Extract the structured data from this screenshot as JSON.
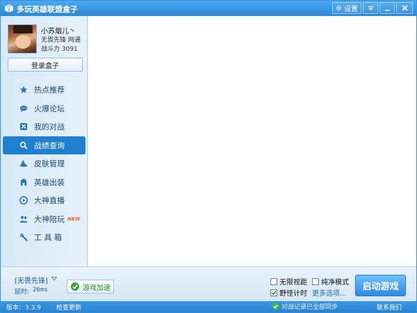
{
  "window": {
    "title": "多玩英雄联盟盒子",
    "settings_label": "设置"
  },
  "user": {
    "name": "小苏烟儿丶",
    "server": "无畏先锋  网通",
    "power": "战斗力  3091"
  },
  "sidebar": {
    "login_label": "登录盒子",
    "items": [
      {
        "label": "热点推荐",
        "icon": "star-icon"
      },
      {
        "label": "火爆论坛",
        "icon": "chat-bubble-icon"
      },
      {
        "label": "我的对战",
        "icon": "battle-icon"
      },
      {
        "label": "战绩查询",
        "icon": "search-icon",
        "active": true
      },
      {
        "label": "皮肤管理",
        "icon": "hat-icon"
      },
      {
        "label": "英雄出装",
        "icon": "armor-icon"
      },
      {
        "label": "大神直播",
        "icon": "play-icon"
      },
      {
        "label": "大神陪玩",
        "icon": "people-icon",
        "badge": "NEW"
      },
      {
        "label": "工 具 箱",
        "icon": "wrench-icon"
      }
    ]
  },
  "bottom": {
    "mode_select": "[无畏先锋]",
    "latency_label": "延时:",
    "latency_value": "26ms",
    "boost_label": "游戏加速",
    "options": {
      "unlimited_view": {
        "label": "无限视距",
        "checked": false
      },
      "pure_mode": {
        "label": "纯净模式",
        "checked": false
      },
      "jungle_timer": {
        "label": "野怪计时",
        "checked": true
      }
    },
    "more_options": "更多选项...",
    "launch_label": "启动游戏"
  },
  "statusbar": {
    "version": "版本：3.3.9",
    "check_update": "检查更新",
    "sync_status": "对战记录已全部同步",
    "contact": "联系我们"
  },
  "colors": {
    "titlebar": "#2a88d8",
    "active_nav": "#1f7fd1",
    "launch_button": "#2a8ae0",
    "statusbar": "#2b82d2",
    "new_badge": "#f26b1d"
  }
}
